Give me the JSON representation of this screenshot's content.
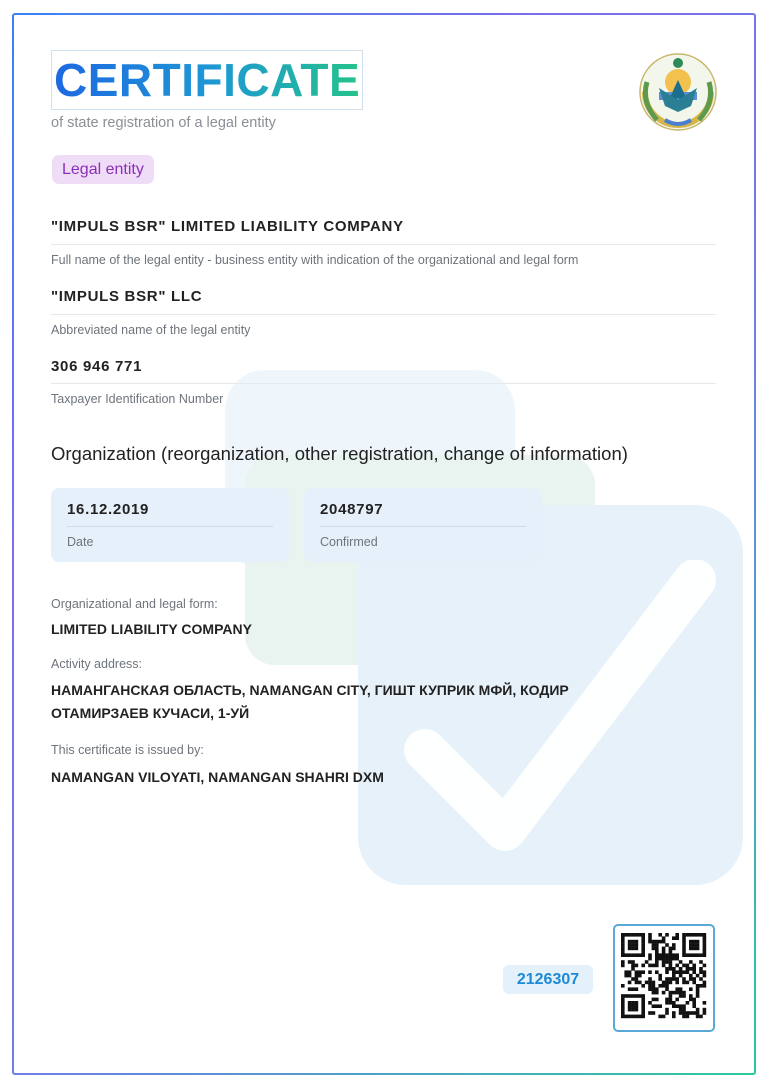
{
  "header": {
    "title": "CERTIFICATE",
    "subtitle": "of state registration of a legal entity"
  },
  "badge": "Legal entity",
  "fields": [
    {
      "value": "\"IMPULS BSR\" LIMITED LIABILITY COMPANY",
      "label": "Full name of the legal entity - business entity with indication of the organizational and legal form"
    },
    {
      "value": "\"IMPULS BSR\" LLC",
      "label": "Abbreviated name of the legal entity"
    },
    {
      "value": "306 946 771",
      "label": "Taxpayer Identification Number"
    }
  ],
  "section_title": "Organization (reorganization, other registration, change of information)",
  "cards": [
    {
      "value": "16.12.2019",
      "label": "Date"
    },
    {
      "value": "2048797",
      "label": "Confirmed"
    }
  ],
  "details": {
    "form_label": "Organizational and legal form:",
    "form_value": "LIMITED LIABILITY COMPANY",
    "address_label": "Activity address:",
    "address_line1": "НАМАНГАНСКАЯ ОБЛАСТЬ, NAMANGAN CITY, ГИШТ КУПРИК МФЙ, КОДИР",
    "address_line2": "ОТАМИРЗАЕВ КУЧАСИ, 1-УЙ",
    "issuer_label": "This certificate is issued by:",
    "issuer_value": "NAMANGAN VILOYATI, NAMANGAN SHAHRI DXM"
  },
  "footer": {
    "certificate_number": "2126307"
  },
  "colors": {
    "title_gradient": [
      "#1e68e0",
      "#25c38a"
    ],
    "badge_bg": "#efdcf6",
    "badge_text": "#8b2fb8",
    "number_text": "#1c8ad6"
  }
}
